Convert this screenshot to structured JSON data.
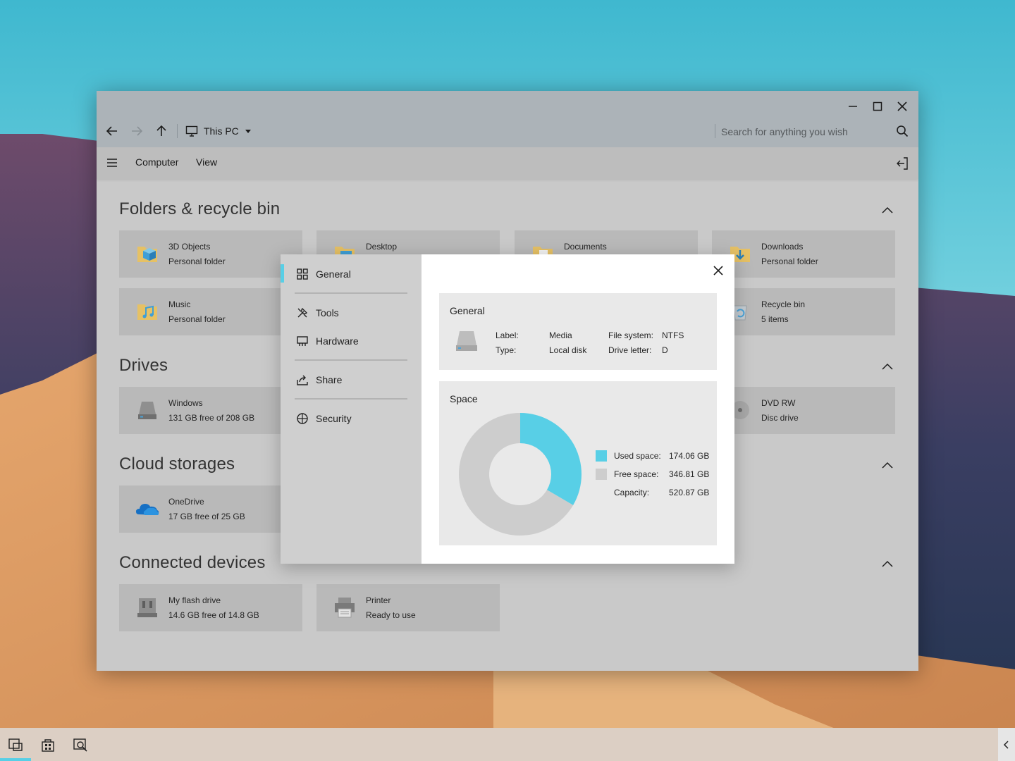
{
  "window": {
    "location": "This PC",
    "search_placeholder": "Search for anything you wish"
  },
  "menubar": {
    "items": [
      {
        "label": "Computer"
      },
      {
        "label": "View"
      }
    ]
  },
  "sections": {
    "folders": {
      "title": "Folders & recycle bin",
      "tiles": [
        {
          "name": "3D Objects",
          "sub": "Personal folder",
          "icon": "3d-objects-folder-icon"
        },
        {
          "name": "Desktop",
          "sub": "",
          "icon": "desktop-folder-icon"
        },
        {
          "name": "Documents",
          "sub": "",
          "icon": "documents-folder-icon"
        },
        {
          "name": "Downloads",
          "sub": "Personal folder",
          "icon": "downloads-folder-icon"
        },
        {
          "name": "Music",
          "sub": "Personal folder",
          "icon": "music-folder-icon"
        },
        {
          "name": "Recycle bin",
          "sub": "5 items",
          "icon": "recycle-bin-icon"
        }
      ]
    },
    "drives": {
      "title": "Drives",
      "tiles": [
        {
          "name": "Windows",
          "sub": "131 GB free of 208 GB",
          "icon": "hard-drive-icon"
        },
        {
          "name": "DVD RW",
          "sub": "Disc drive",
          "icon": "disc-drive-icon"
        }
      ]
    },
    "cloud": {
      "title": "Cloud storages",
      "tiles": [
        {
          "name": "OneDrive",
          "sub": "17 GB free of 25 GB",
          "icon": "onedrive-cloud-icon"
        }
      ]
    },
    "devices": {
      "title": "Connected devices",
      "tiles": [
        {
          "name": "My flash drive",
          "sub": "14.6 GB free of 14.8 GB",
          "icon": "usb-drive-icon"
        },
        {
          "name": "Printer",
          "sub": "Ready to use",
          "icon": "printer-icon"
        }
      ]
    }
  },
  "dialog": {
    "nav": [
      {
        "label": "General",
        "icon": "grid-icon",
        "active": true
      },
      {
        "label": "Tools",
        "icon": "tools-icon"
      },
      {
        "label": "Hardware",
        "icon": "hardware-icon"
      },
      {
        "label": "Share",
        "icon": "share-icon"
      },
      {
        "label": "Security",
        "icon": "security-icon"
      }
    ],
    "general": {
      "title": "General",
      "label_key": "Label:",
      "label_val": "Media",
      "type_key": "Type:",
      "type_val": "Local disk",
      "fs_key": "File system:",
      "fs_val": "NTFS",
      "letter_key": "Drive letter:",
      "letter_val": "D"
    },
    "space": {
      "title": "Space",
      "used_label": "Used space:",
      "used_value": "174.06 GB",
      "free_label": "Free space:",
      "free_value": "346.81 GB",
      "capacity_label": "Capacity:",
      "capacity_value": "520.87 GB",
      "used_fraction": 0.334,
      "used_color": "#58cfe6",
      "free_color": "#cdcdcd"
    }
  },
  "colors": {
    "accent": "#58cfe6"
  }
}
